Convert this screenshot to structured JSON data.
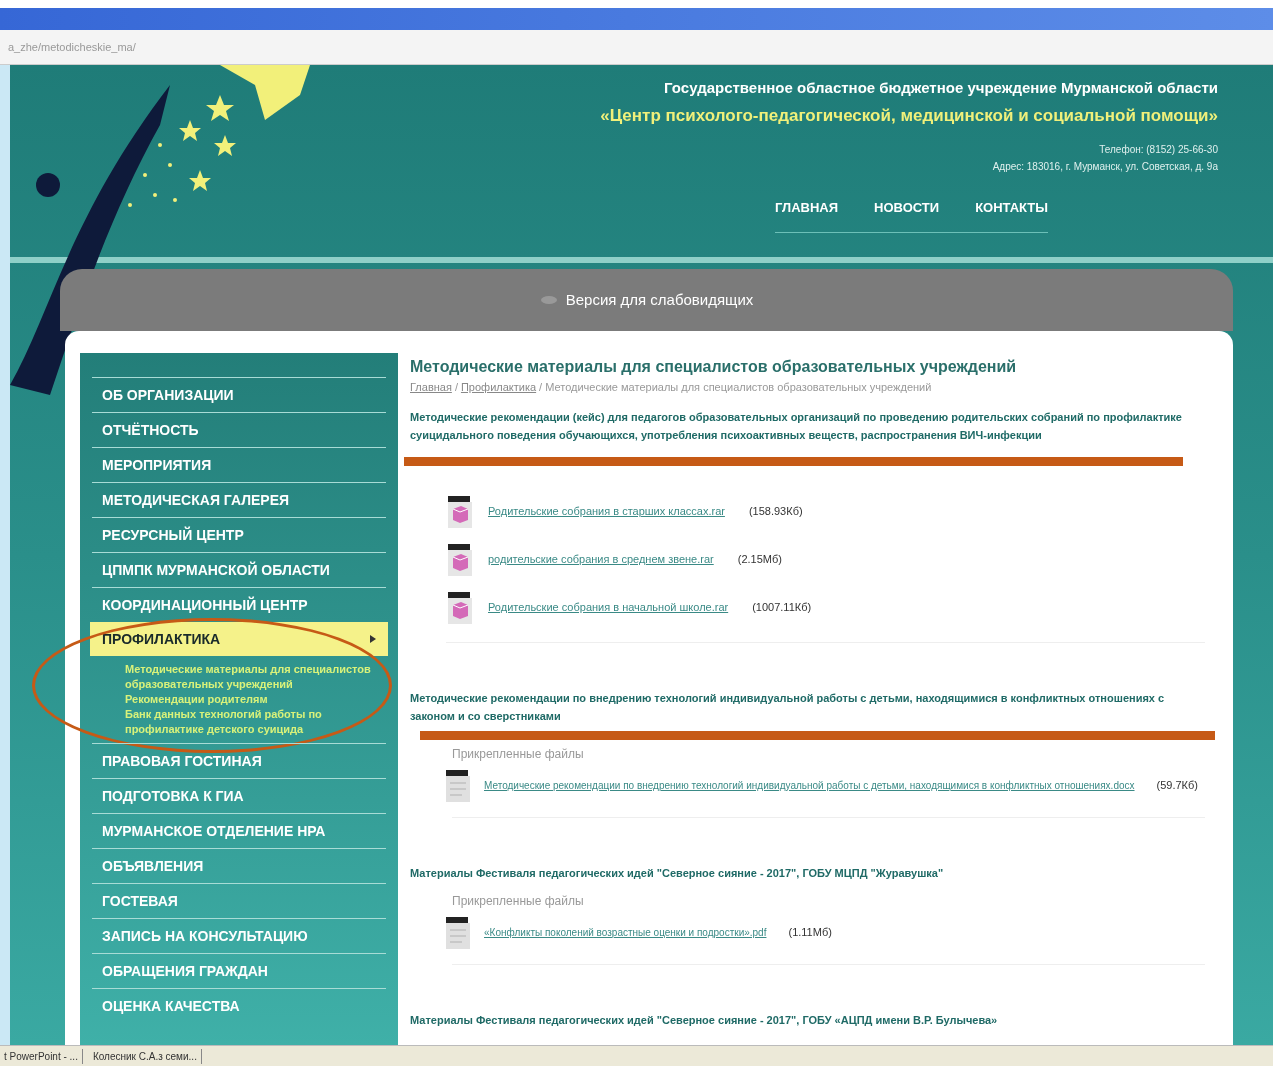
{
  "browser": {
    "address": "a_zhe/metodicheskie_ma/"
  },
  "header": {
    "org_line": "Государственное областное бюджетное учреждение Мурманской области",
    "center_name": "«Центр психолого-педагогической, медицинской и социальной помощи»",
    "phone": "Телефон: (8152) 25-66-30",
    "address": "Адрес: 183016, г. Мурманск, ул. Советская, д. 9а",
    "nav": [
      {
        "label": "ГЛАВНАЯ"
      },
      {
        "label": "НОВОСТИ"
      },
      {
        "label": "КОНТАКТЫ"
      }
    ]
  },
  "accessibility_bar": {
    "label": "Версия для слабовидящих"
  },
  "sidebar": {
    "items": [
      {
        "label": "ОБ ОРГАНИЗАЦИИ",
        "selected": false
      },
      {
        "label": "ОТЧЁТНОСТЬ",
        "selected": false
      },
      {
        "label": "МЕРОПРИЯТИЯ",
        "selected": false
      },
      {
        "label": "МЕТОДИЧЕСКАЯ ГАЛЕРЕЯ",
        "selected": false
      },
      {
        "label": "РЕСУРСНЫЙ ЦЕНТР",
        "selected": false
      },
      {
        "label": "ЦПМПК МУРМАНСКОЙ ОБЛАСТИ",
        "selected": false
      },
      {
        "label": "КООРДИНАЦИОННЫЙ ЦЕНТР",
        "selected": false
      },
      {
        "label": "ПРОФИЛАКТИКА",
        "selected": true,
        "circled": true,
        "children": [
          {
            "label": "Методические материалы для специалистов образовательных учреждений"
          },
          {
            "label": "Рекомендации родителям"
          },
          {
            "label": "Банк данных технологий работы по профилактике детского суицида"
          }
        ]
      },
      {
        "label": "ПРАВОВАЯ ГОСТИНАЯ",
        "selected": false
      },
      {
        "label": "ПОДГОТОВКА К ГИА",
        "selected": false
      },
      {
        "label": "МУРМАНСКОЕ ОТДЕЛЕНИЕ НРА",
        "selected": false
      },
      {
        "label": "ОБЪЯВЛЕНИЯ",
        "selected": false
      },
      {
        "label": "ГОСТЕВАЯ",
        "selected": false
      },
      {
        "label": "ЗАПИСЬ НА КОНСУЛЬТАЦИЮ",
        "selected": false
      },
      {
        "label": "ОБРАЩЕНИЯ ГРАЖДАН",
        "selected": false
      },
      {
        "label": "ОЦЕНКА КАЧЕСТВА",
        "selected": false
      }
    ]
  },
  "content": {
    "title": "Методические материалы для специалистов образовательных учреждений",
    "breadcrumb": {
      "separator": "/",
      "items": [
        {
          "label": "Главная",
          "link": true
        },
        {
          "label": "Профилактика",
          "link": true
        },
        {
          "label": "Методические материалы для специалистов образовательных учреждений",
          "link": false
        }
      ]
    },
    "sections": [
      {
        "title": "Методические рекомендации (кейс) для педагогов образовательных организаций по проведению родительских собраний по профилактике суицидального поведения обучающихся, употребления психоактивных веществ, распространения ВИЧ-инфекции",
        "underlined": true,
        "files": [
          {
            "name": "Родительские собрания в старших классах.rar",
            "size": "(158.93Кб)",
            "kind": "archive"
          },
          {
            "name": "родительские собрания в среднем звене.rar",
            "size": "(2.15Мб)",
            "kind": "archive"
          },
          {
            "name": "Родительские собрания в начальной школе.rar",
            "size": "(1007.11Кб)",
            "kind": "archive"
          }
        ]
      },
      {
        "title": "Методические рекомендации по внедрению технологий индивидуальной работы с детьми, находящимися в конфликтных отношениях с законом и со сверстниками",
        "underlined": true,
        "files_label": "Прикрепленные файлы",
        "files": [
          {
            "name": "Методические рекомендации по внедрению технологий индивидуальной работы с детьми, находящимися в конфликтных отношениях.docx",
            "size": "(59.7Кб)",
            "kind": "document"
          }
        ]
      },
      {
        "title": "Материалы Фестиваля педагогических идей \"Северное сияние - 2017\", ГОБУ МЦПД \"Журавушка\"",
        "underlined": false,
        "files_label": "Прикрепленные файлы",
        "files": [
          {
            "name": "«Конфликты поколений возрастные оценки и подростки».pdf",
            "size": "(1.11Мб)",
            "kind": "document"
          }
        ]
      },
      {
        "title": "Материалы Фестиваля педагогических идей \"Северное сияние - 2017\", ГОБУ «АЦПД имени В.Р. Булычева»",
        "underlined": false
      }
    ]
  },
  "taskbar": {
    "items": [
      {
        "label": "t PowerPoint - ..."
      },
      {
        "label": "Колесник С.А.з семи..."
      }
    ]
  }
}
